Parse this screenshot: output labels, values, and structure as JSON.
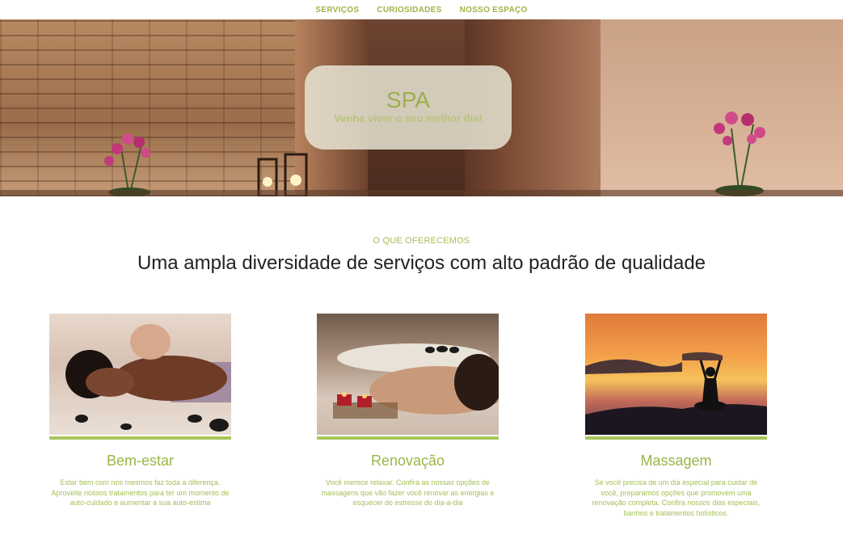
{
  "nav": {
    "items": [
      "SERVIÇOS",
      "CURIOSIDADES",
      "NOSSO ESPAÇO"
    ]
  },
  "hero": {
    "title": "SPA",
    "subtitle": "Venha viver o seu melhor dia!"
  },
  "services": {
    "overline": "O QUE OFERECEMOS",
    "headline": "Uma ampla diversidade de serviços com alto padrão de qualidade",
    "cards": [
      {
        "title": "Bem-estar",
        "text": "Estar bem com nós mesmos faz toda a diferença. Aproveite nossos tratamentos para ter um momento de auto-cuidado e aumentar a sua auto-estima"
      },
      {
        "title": "Renovação",
        "text": "Você merece relaxar. Confira as nossas opções de massagens que vão fazer você renovar as energias e esquecer do estresse do dia-a-dia"
      },
      {
        "title": "Massagem",
        "text": "Se você precisa de um dia especial para cuidar de você, preparamos opções que promovem uma renovação completa. Confira nossos dias especiais, banhos e tratamentos holísticos."
      }
    ]
  },
  "colors": {
    "accent": "#9cb548",
    "accent_light": "#a8c65a"
  }
}
